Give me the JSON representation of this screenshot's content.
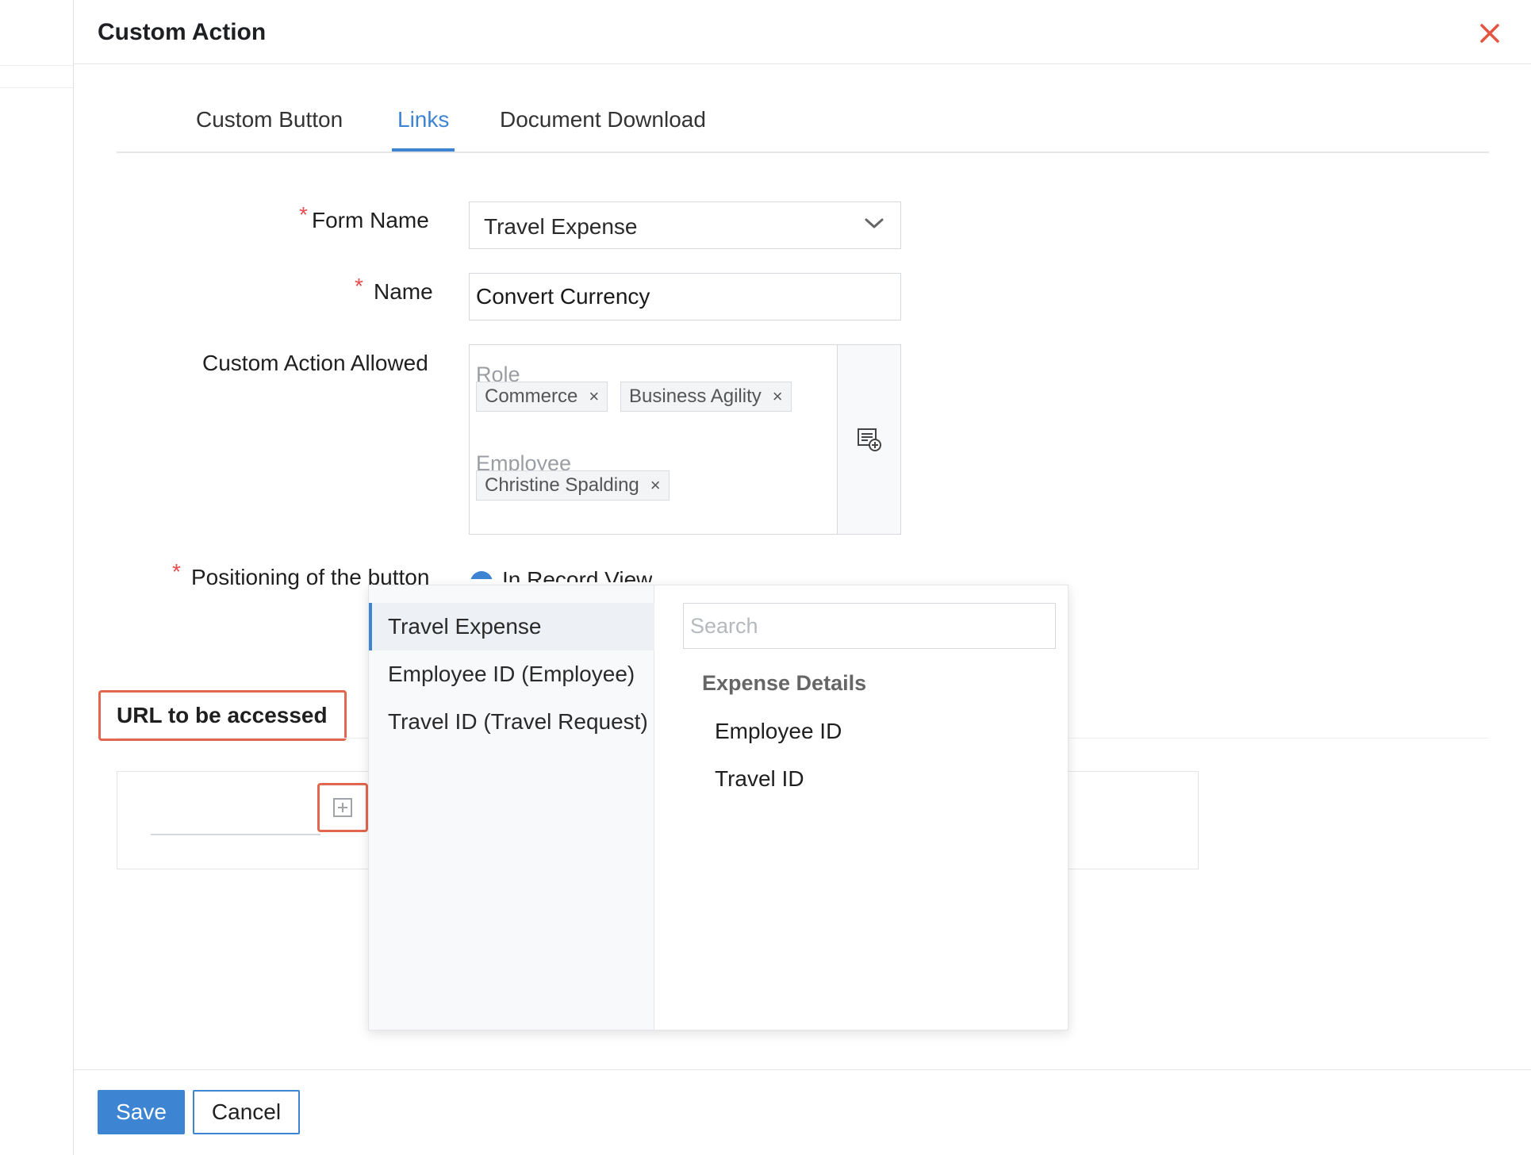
{
  "dialog": {
    "title": "Custom Action"
  },
  "tabs": [
    {
      "label": "Custom Button"
    },
    {
      "label": "Links"
    },
    {
      "label": "Document Download"
    }
  ],
  "form": {
    "form_name_label": "Form Name",
    "form_name_value": "Travel Expense",
    "name_label": "Name",
    "name_value": "Convert Currency",
    "allowed_label": "Custom Action Allowed",
    "allowed_groups": [
      {
        "title": "Role",
        "chips": [
          "Commerce",
          "Business Agility"
        ]
      },
      {
        "title": "Employee",
        "chips": [
          "Christine Spalding"
        ]
      }
    ],
    "position_label": "Positioning of the button",
    "position_option": "In Record View",
    "required_mark": "*"
  },
  "url_section": {
    "heading": "URL to be accessed"
  },
  "field_picker": {
    "forms": [
      "Travel Expense",
      "Employee ID (Employee)",
      "Travel ID (Travel Request)"
    ],
    "search_placeholder": "Search",
    "group_title": "Expense Details",
    "fields": [
      "Employee ID",
      "Travel ID"
    ]
  },
  "footer": {
    "save_label": "Save",
    "cancel_label": "Cancel"
  },
  "colors": {
    "accent": "#3d84d3",
    "highlight": "#e2674f",
    "close": "#e4553f",
    "required": "#e84c4c"
  },
  "icons": {
    "close": "close-icon",
    "chevron": "chevron-down-icon",
    "add_list": "add-list-icon",
    "insert": "insert-field-icon",
    "chip_remove": "×"
  }
}
